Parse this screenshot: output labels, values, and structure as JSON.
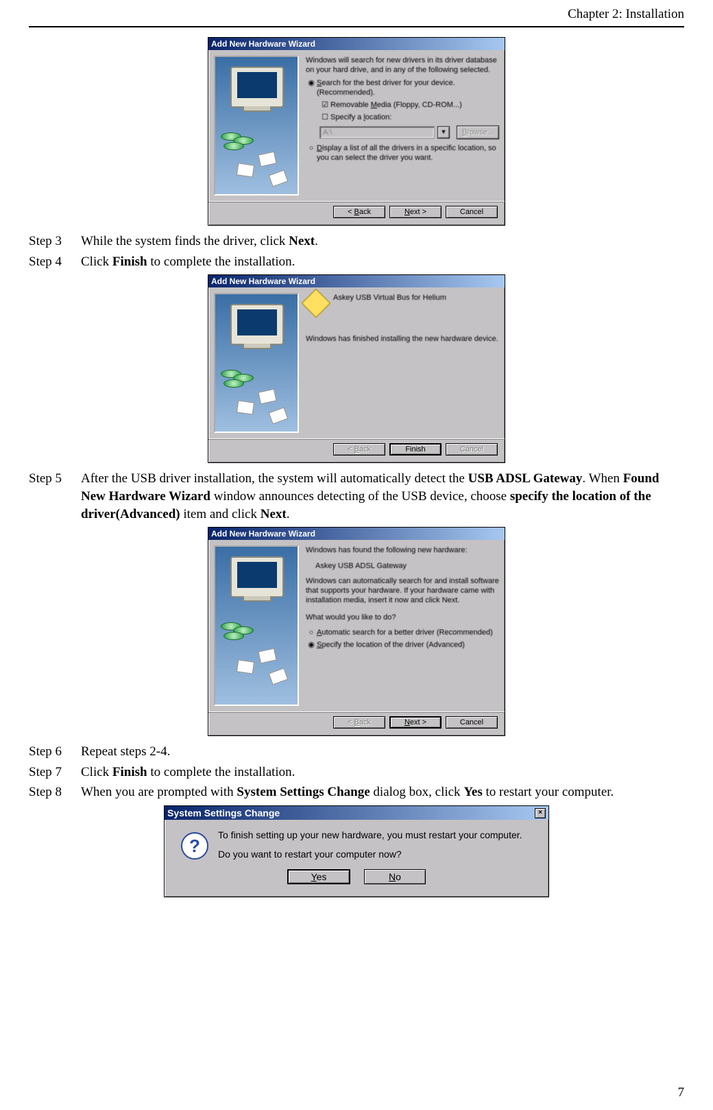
{
  "header": {
    "chapter": "Chapter 2: Installation"
  },
  "page_number": "7",
  "steps": {
    "s3": {
      "label": "Step 3",
      "pre": "While the system finds the driver, click ",
      "b1": "Next",
      "post": "."
    },
    "s4": {
      "label": "Step 4",
      "pre": "Click ",
      "b1": "Finish",
      "post": " to complete the installation."
    },
    "s5": {
      "label": "Step 5",
      "pre": "After the USB driver installation, the system will automatically detect the ",
      "b1": "USB ADSL Gateway",
      "mid1": ". When ",
      "b2": "Found New Hardware Wizard",
      "mid2": " window announces detecting of the USB device, choose ",
      "b3": "specify the location of the driver(Advanced)",
      "mid3": " item and click ",
      "b4": "Next",
      "post": "."
    },
    "s6": {
      "label": "Step 6",
      "text": "Repeat steps 2-4."
    },
    "s7": {
      "label": "Step 7",
      "pre": "Click ",
      "b1": "Finish",
      "post": " to complete the installation."
    },
    "s8": {
      "label": "Step 8",
      "pre": "When you are prompted with ",
      "b1": "System Settings Change",
      "mid1": " dialog box, click ",
      "b2": "Yes",
      "post": " to restart your computer."
    }
  },
  "dlg1": {
    "title": "Add New Hardware Wizard",
    "intro": "Windows will search for new drivers in its driver database on your hard drive, and in any of the following selected.",
    "opt_search_pre": "S",
    "opt_search_rest": "earch for the best driver for your device. (Recommended).",
    "chk_media_pre": "Removable ",
    "chk_media_u": "M",
    "chk_media_rest": "edia (Floppy, CD-ROM...)",
    "chk_loc": "Specify a ",
    "chk_loc_u": "l",
    "chk_loc_rest": "ocation:",
    "loc_value": "A:\\",
    "browse_u": "B",
    "browse_rest": "rowse...",
    "opt_display_u": "D",
    "opt_display_rest": "isplay a list of all the drivers in a specific location, so you can select the driver you want.",
    "btn_back_pre": "< ",
    "btn_back_u": "B",
    "btn_back_rest": "ack",
    "btn_next_u": "N",
    "btn_next_rest": "ext >",
    "btn_cancel": "Cancel"
  },
  "dlg2": {
    "title": "Add New Hardware Wizard",
    "device": "Askey  USB Virtual Bus for Helium",
    "done": "Windows has finished installing the new hardware device.",
    "btn_back_pre": "< ",
    "btn_back_u": "B",
    "btn_back_rest": "ack",
    "btn_finish": "Finish",
    "btn_cancel": "Cancel"
  },
  "dlg3": {
    "title": "Add New Hardware Wizard",
    "found": "Windows has found the following new hardware:",
    "device": "Askey  USB ADSL Gateway",
    "auto_text": "Windows can automatically search for and install software that supports your hardware. If your hardware came with installation media, insert it now and click Next.",
    "ask": "What would you like to do?",
    "opt_auto_u": "A",
    "opt_auto_rest": "utomatic search for a better driver (Recommended)",
    "opt_spec_u": "S",
    "opt_spec_rest": "pecify the location of the driver (Advanced)",
    "btn_back_pre": "< ",
    "btn_back_u": "B",
    "btn_back_rest": "ack",
    "btn_next_u": "N",
    "btn_next_rest": "ext >",
    "btn_cancel": "Cancel"
  },
  "dlg4": {
    "title": "System Settings Change",
    "line1": "To finish setting up your new hardware, you must restart your computer.",
    "line2": "Do you want to restart your computer now?",
    "yes_u": "Y",
    "yes_rest": "es",
    "no_u": "N",
    "no_rest": "o",
    "qmark": "?",
    "close_x": "×"
  }
}
